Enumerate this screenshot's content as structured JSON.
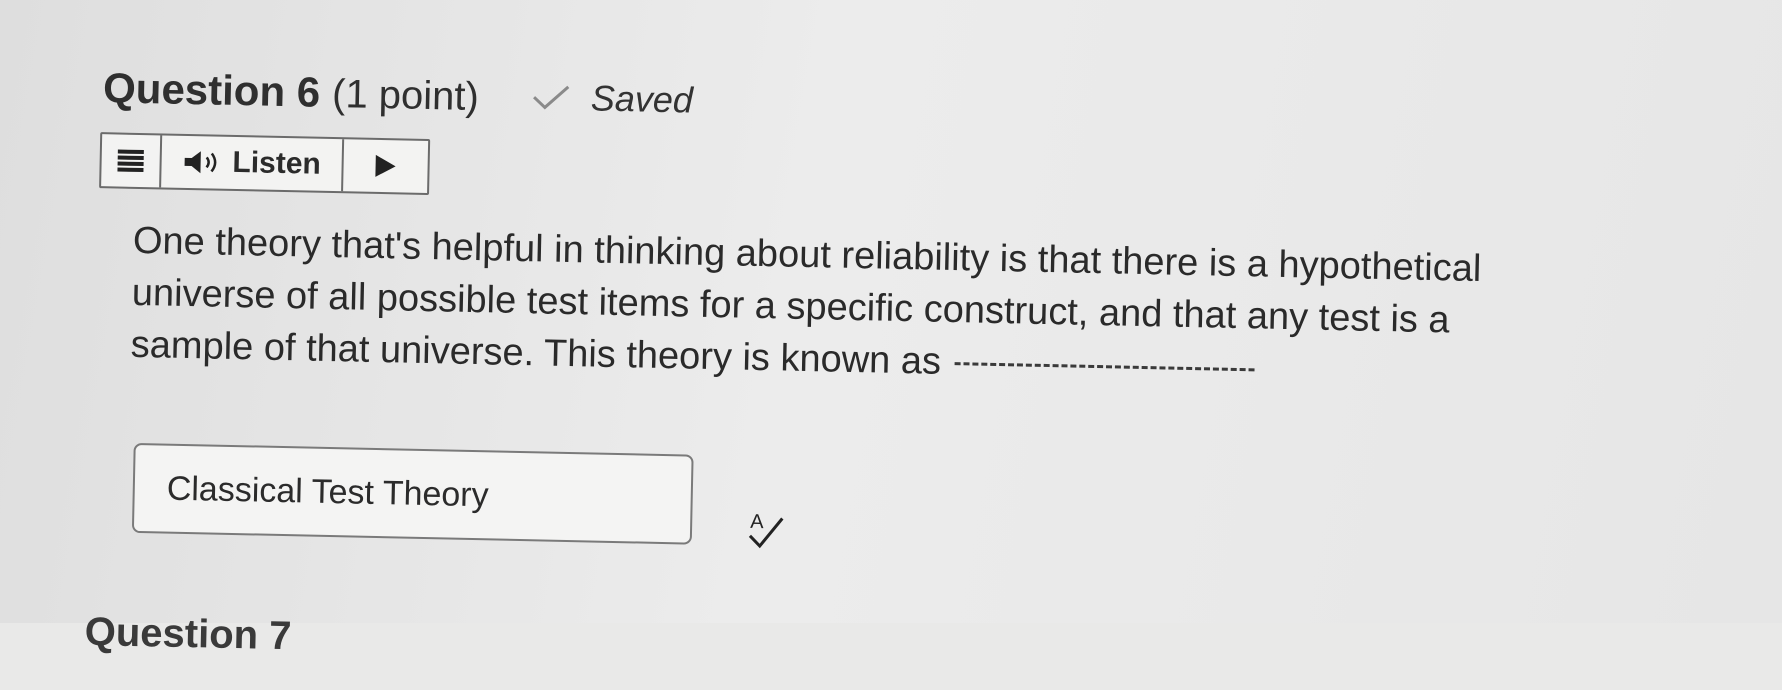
{
  "question": {
    "title": "Question 6",
    "points": "(1 point)",
    "status": "Saved"
  },
  "listen_toolbar": {
    "label": "Listen"
  },
  "body": {
    "lines": [
      "One theory that's helpful in thinking about reliability is that there is a hypothetical",
      "universe of all possible test items for a specific construct, and that any test is a",
      "sample of that universe.  This theory is known as"
    ]
  },
  "answer": {
    "value": "Classical Test Theory"
  },
  "next_question": {
    "title_partial": "Question 7"
  },
  "icons": {
    "status": "check-icon",
    "menu": "menu-icon",
    "speaker": "speaker-icon",
    "play": "play-icon",
    "spellcheck": "spellcheck-icon"
  },
  "colors": {
    "background": "#e9e9e8",
    "text": "#2b2b2b",
    "border": "#6b6b6b"
  }
}
